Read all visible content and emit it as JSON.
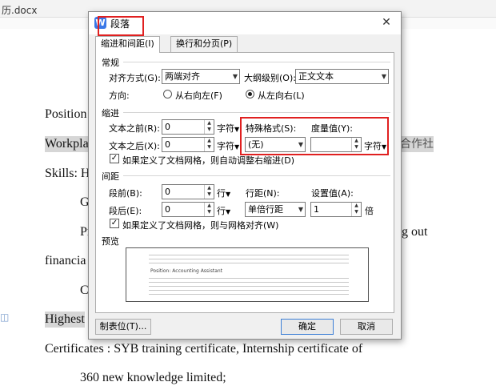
{
  "document": {
    "file_name": "历.docx",
    "lines": {
      "position": "Position",
      "workplace": "Workpla",
      "workplace_right": "合作社",
      "skills": "Skills: H",
      "g": "G",
      "pr": "Pr",
      "g_out": "g   out",
      "financial": "financia",
      "co": "Co",
      "highest": "Highest",
      "certificates": "Certificates : SYB training    certificate,    Internship certificate of",
      "knowledge": "360 new knowledge limited;"
    }
  },
  "dialog": {
    "title": "段落",
    "tabs": [
      {
        "label": "缩进和间距(I)",
        "active": true
      },
      {
        "label": "换行和分页(P)",
        "active": false
      }
    ],
    "general": {
      "heading": "常规",
      "alignment_label": "对齐方式(G):",
      "alignment_value": "两端对齐",
      "outline_label": "大纲级别(O):",
      "outline_value": "正文文本",
      "direction_label": "方向:",
      "rtl_label": "从右向左(F)",
      "ltr_label": "从左向右(L)",
      "direction_selected": "ltr"
    },
    "indent": {
      "heading": "缩进",
      "before_label": "文本之前(R):",
      "before_value": "0",
      "before_unit": "字符",
      "after_label": "文本之后(X):",
      "after_value": "0",
      "after_unit": "字符",
      "special_label": "特殊格式(S):",
      "special_value": "(无)",
      "measure_label": "度量值(Y):",
      "measure_value": "",
      "measure_unit": "字符",
      "grid_check_label": "如果定义了文档网格，则自动调整右缩进(D)",
      "grid_checked": true
    },
    "spacing": {
      "heading": "间距",
      "before_label": "段前(B):",
      "before_value": "0",
      "before_unit": "行",
      "after_label": "段后(E):",
      "after_value": "0",
      "after_unit": "行",
      "line_label": "行距(N):",
      "line_value": "单倍行距",
      "set_label": "设置值(A):",
      "set_value": "1",
      "set_unit": "倍",
      "grid_check_label": "如果定义了文档网格，则与网格对齐(W)",
      "grid_checked": true
    },
    "preview": {
      "heading": "预览",
      "sample_text": "Position: Accounting Assistant"
    },
    "buttons": {
      "tabs_label": "制表位(T)...",
      "ok_label": "确定",
      "cancel_label": "取消"
    },
    "highlight_color": "#e02020"
  }
}
